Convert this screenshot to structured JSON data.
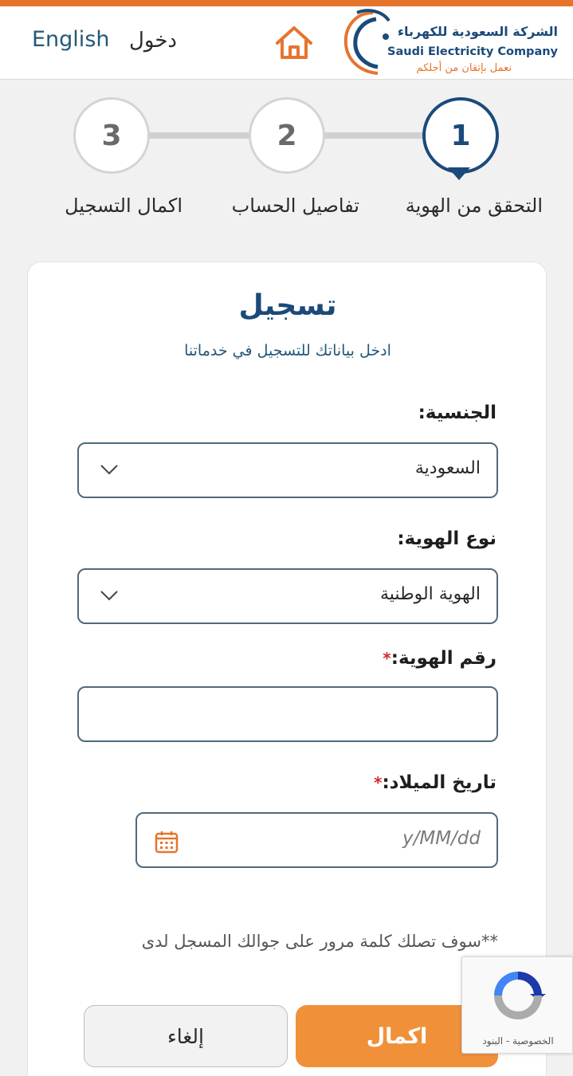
{
  "header": {
    "lang_link": "English",
    "login_link": "دخول",
    "home_icon": "home-icon",
    "logo": {
      "name_ar": "الشركة السعودية للكهرباء",
      "name_en": "Saudi Electricity Company",
      "tagline": "نعمل بإتقان من أجلكم"
    }
  },
  "stepper": {
    "steps": [
      {
        "number": "1",
        "label": "التحقق من الهوية",
        "active": true
      },
      {
        "number": "2",
        "label": "تفاصيل الحساب",
        "active": false
      },
      {
        "number": "3",
        "label": "اكمال التسجيل",
        "active": false
      }
    ]
  },
  "form": {
    "title": "تسجيل",
    "subtitle": "ادخل بياناتك للتسجيل في خدماتنا",
    "nationality": {
      "label": "الجنسية:",
      "value": "السعودية"
    },
    "id_type": {
      "label": "نوع الهوية:",
      "value": "الهوية الوطنية"
    },
    "id_number": {
      "required_mark": "*",
      "label": "رقم الهوية:",
      "value": ""
    },
    "birth_date": {
      "required_mark": "*",
      "label": "تاريخ الميلاد:",
      "placeholder": "y/MM/dd"
    },
    "note": "**سوف تصلك كلمة مرور على جوالك المسجل لدى",
    "complete_button": "اكمال",
    "cancel_button": "إلغاء"
  },
  "recaptcha": {
    "links": "الخصوصية - البنود"
  },
  "colors": {
    "brand_blue": "#1b4a7a",
    "brand_orange": "#e7742d",
    "button_orange": "#f0913a"
  }
}
